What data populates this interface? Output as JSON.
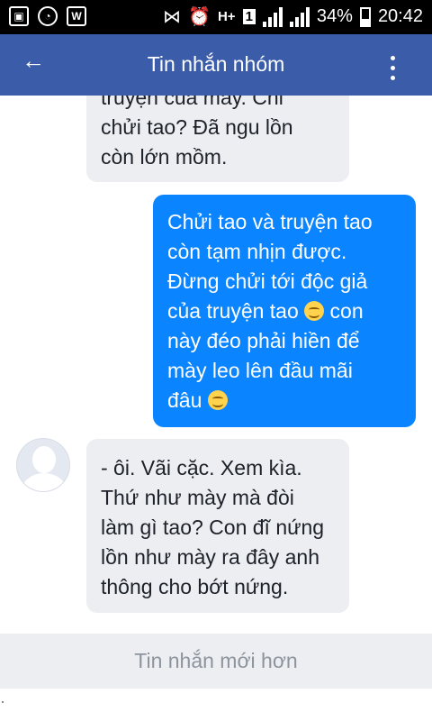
{
  "status_bar": {
    "sim_label": "1",
    "network_label": "H+",
    "battery": "34%",
    "time": "20:42"
  },
  "header": {
    "back_symbol": "←",
    "title": "Tin nhắn nhóm"
  },
  "messages": [
    {
      "direction": "incoming",
      "lines": [
        "truyện của mày. Chỉ",
        "chửi tao? Đã ngu lồn",
        "còn lớn mồm."
      ]
    },
    {
      "direction": "outgoing",
      "lines": [
        "Chửi tao và truyện tao",
        "còn tạm nhịn được.",
        "Đừng chửi tới độc giả",
        "của truyện tao",
        "này đéo phải hiền để",
        "mày leo lên đầu mãi",
        "đâu"
      ],
      "line4_suffix": " con"
    },
    {
      "direction": "incoming",
      "lines": [
        "- ôi. Vãi cặc. Xem kìa.",
        "Thứ như mày mà đòi",
        "làm gì tao? Con đĩ nứng",
        "lồn như mày ra đây anh",
        "thông cho bớt nứng."
      ]
    }
  ],
  "footer": {
    "newer_messages_label": "Tin nhắn mới hơn"
  },
  "colors": {
    "app_bar": "#3b5ca8",
    "outgoing_bubble": "#0a84ff",
    "incoming_bubble": "#eceef1"
  }
}
